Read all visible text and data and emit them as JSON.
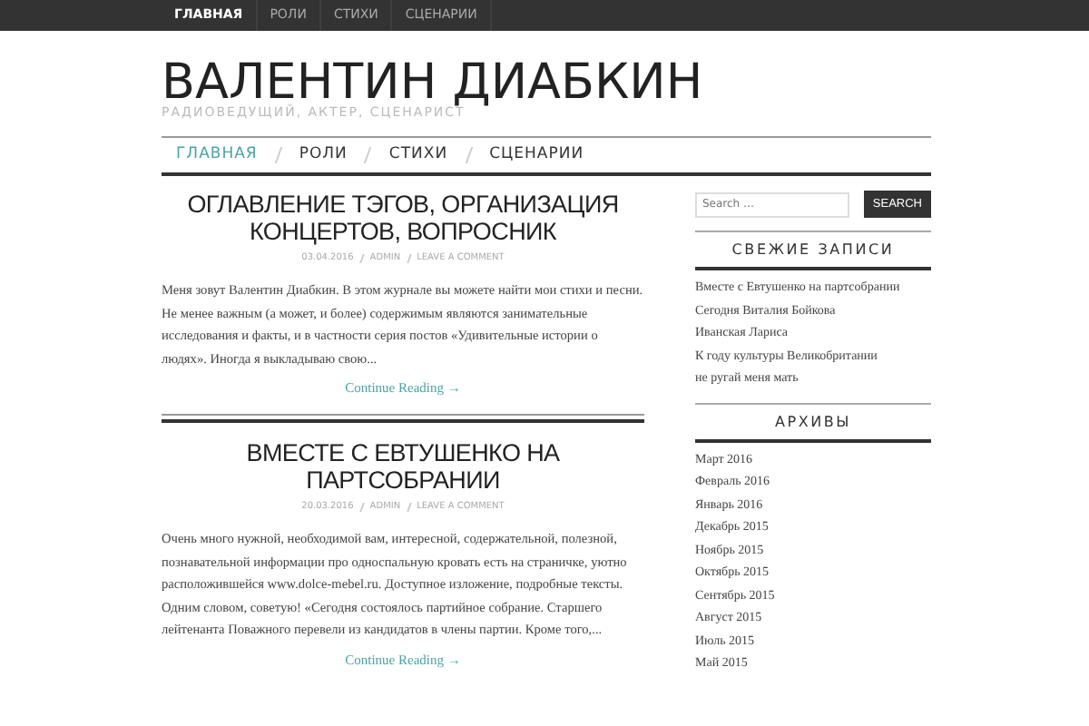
{
  "top_menu": [
    {
      "label": "ГЛАВНАЯ",
      "selected": true
    },
    {
      "label": "РОЛИ",
      "selected": false
    },
    {
      "label": "СТИХИ",
      "selected": false
    },
    {
      "label": "СЦЕНАРИИ",
      "selected": false
    }
  ],
  "site": {
    "title": "ВАЛЕНТИН ДИАБКИН",
    "tagline": "РАДИОВЕДУЩИЙ, АКТЕР, СЦЕНАРИСТ"
  },
  "main_menu": [
    {
      "label": "ГЛАВНАЯ",
      "selected": true
    },
    {
      "label": "РОЛИ",
      "selected": false
    },
    {
      "label": "СТИХИ",
      "selected": false
    },
    {
      "label": "СЦЕНАРИИ",
      "selected": false
    }
  ],
  "posts": [
    {
      "title": "ОГЛАВЛЕНИЕ ТЭГОВ, ОРГАНИЗАЦИЯ КОНЦЕРТОВ, ВОПРОСНИК",
      "meta": [
        "03.04.2016",
        "ADMIN",
        "LEAVE A COMMENT"
      ],
      "excerpt": "Меня зовут Валентин Диабкин. В этом журнале вы можете найти мои стихи и песни. Не менее важным (а может, и более) содержимым являются занимательные исследования и факты, и в частности серия постов «Удивительные истории о людях». Иногда я выкладываю свою...",
      "more": "Continue Reading →"
    },
    {
      "title": "ВМЕСТЕ С ЕВТУШЕНКО НА ПАРТСОБРАНИИ",
      "meta": [
        "20.03.2016",
        "ADMIN",
        "LEAVE A COMMENT"
      ],
      "excerpt": "Очень много нужной, необходимой вам, интересной, содержательной, полезной, познавательной информации про односпальную кровать есть на страничке, уютно расположившейся www.dolce-mebel.ru. Доступное изложение, подробные тексты. Одним словом, советую! «Сегодня состоялось партийное собрание. Старшего лейтенанта Поважного перевели из кандидатов в члены партии. Кроме того,...",
      "more": "Continue Reading →"
    }
  ],
  "sidebar": {
    "search": {
      "placeholder": "Search …",
      "button": "SEARCH"
    },
    "recent": {
      "title": "СВЕЖИЕ ЗАПИСИ",
      "items": [
        "Вместе с Евтушенко на партсобрании",
        "Сегодня Виталия Бойкова",
        "Иванская Лариса",
        "К году культуры Великобритании",
        "не ругай меня мать"
      ]
    },
    "archives": {
      "title": "АРХИВЫ",
      "items": [
        "Март 2016",
        "Февраль 2016",
        "Январь 2016",
        "Декабрь 2015",
        "Ноябрь 2015",
        "Октябрь 2015",
        "Сентябрь 2015",
        "Август 2015",
        "Июль 2015",
        "Май 2015"
      ]
    }
  }
}
